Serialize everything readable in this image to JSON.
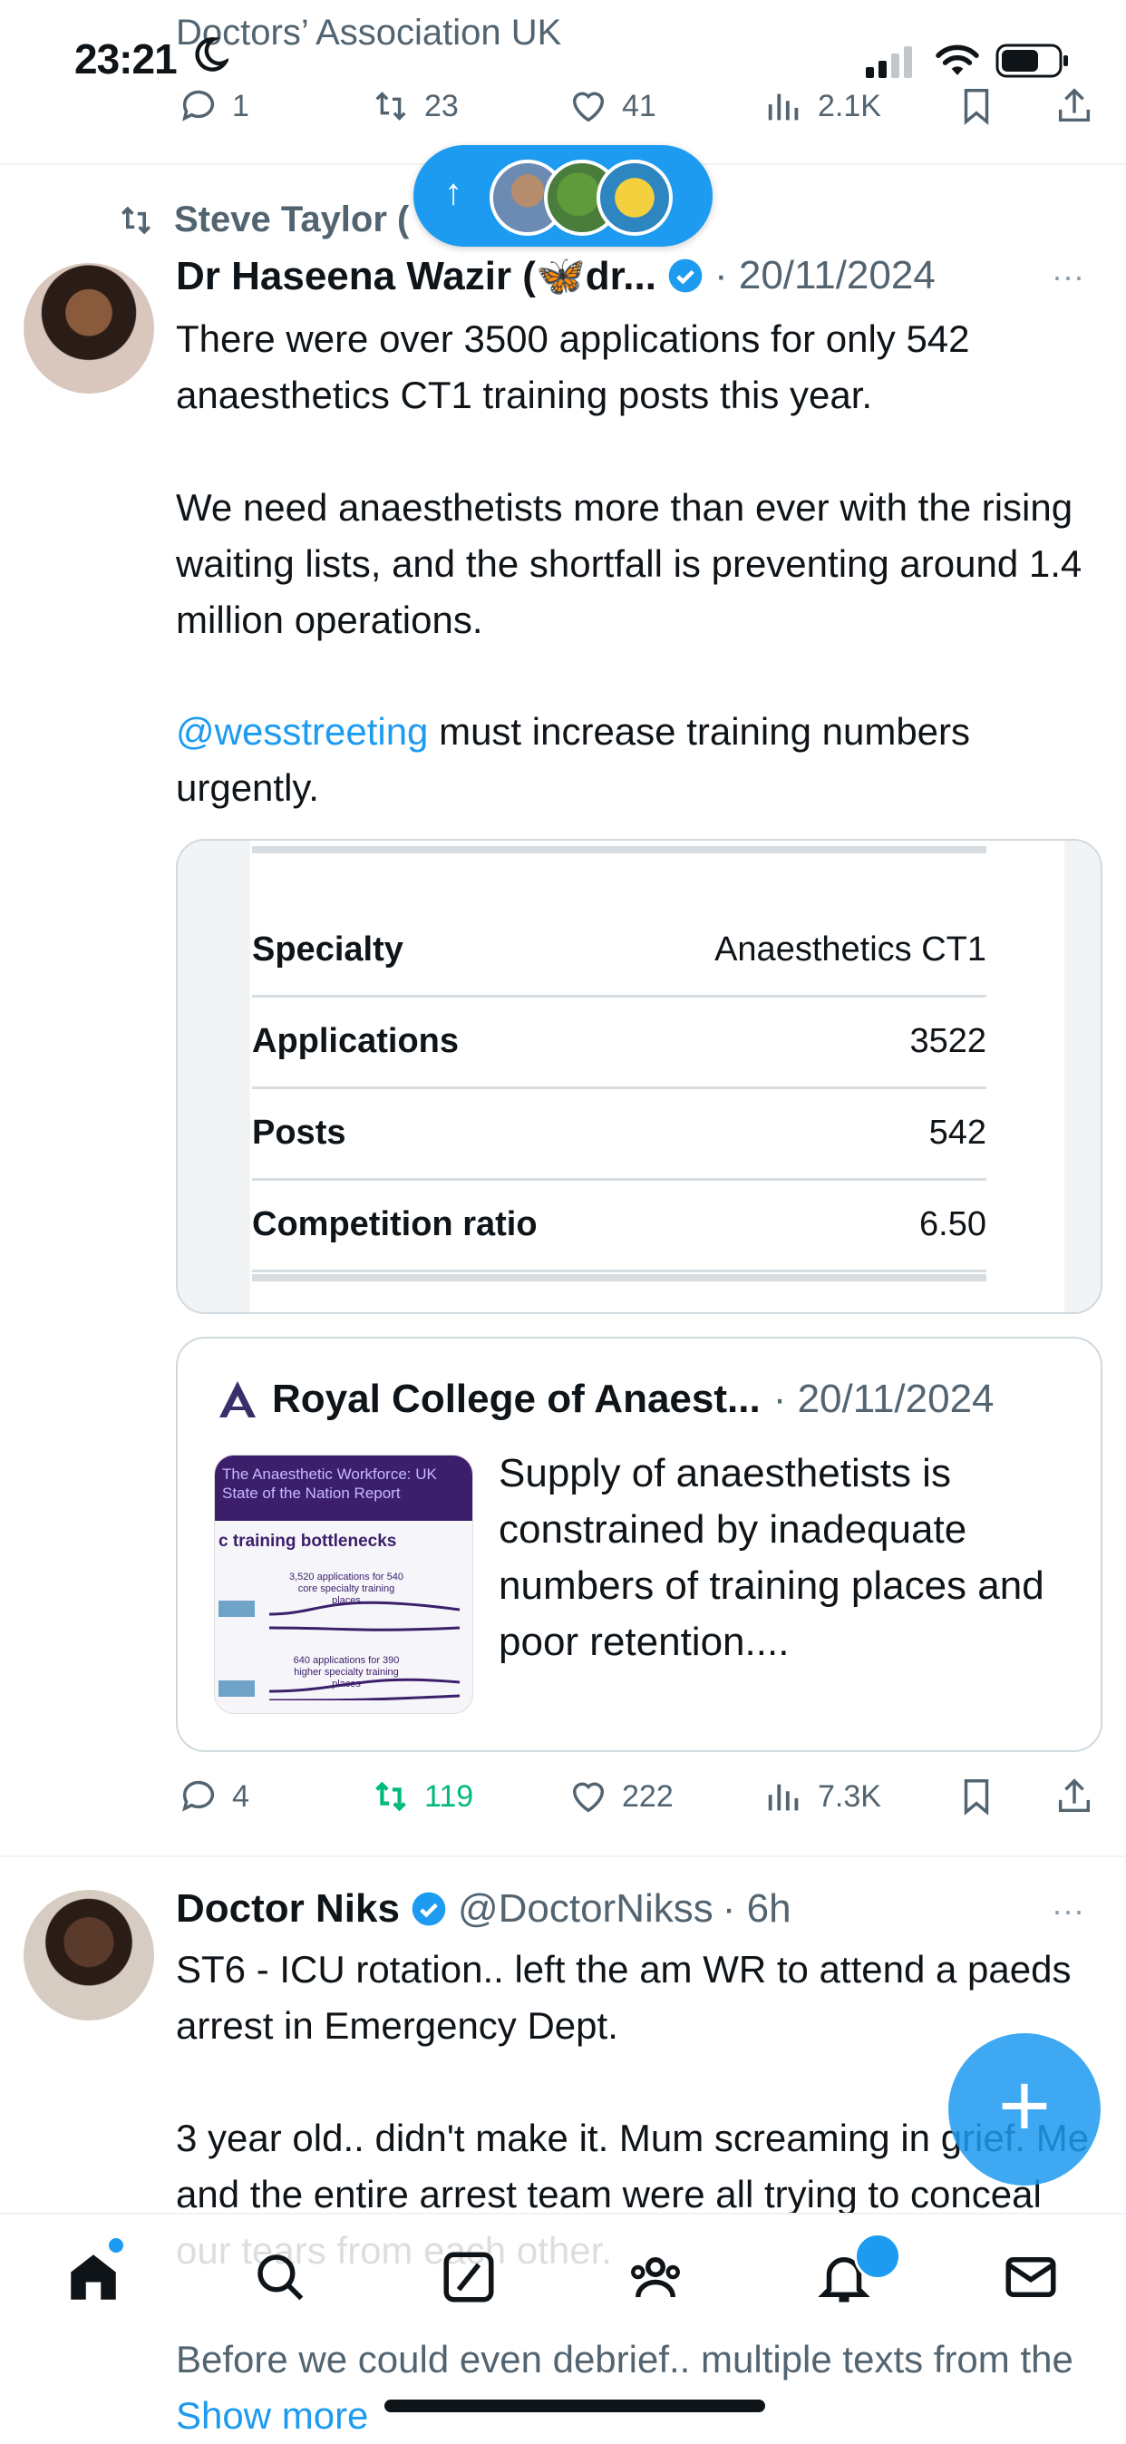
{
  "status": {
    "time": "23:21"
  },
  "previous_post": {
    "author_fragment": "Doctors’ Association UK",
    "replies": "1",
    "reposts": "23",
    "likes": "41",
    "views": "2.1K"
  },
  "new_posts_pill": {
    "arrow": "↑"
  },
  "post1": {
    "repost_by": "Steve Taylor (",
    "name": "Dr Haseena Wazir (🦋dr...",
    "date": "· 20/11/2024",
    "more": "···",
    "text_p1": "There were over 3500 applications for only 542 anaesthetics CT1 training posts this year.",
    "text_p2": "We need anaesthetists more than ever with the rising waiting lists, and the shortfall is preventing around 1.4 million operations.",
    "mention": "@wesstreeting",
    "text_p3": " must increase training numbers urgently.",
    "table": [
      {
        "k": "Specialty",
        "v": "Anaesthetics CT1"
      },
      {
        "k": "Applications",
        "v": "3522"
      },
      {
        "k": "Posts",
        "v": "542"
      },
      {
        "k": "Competition ratio",
        "v": "6.50"
      }
    ],
    "quote": {
      "name": "Royal College of Anaest...",
      "date": "· 20/11/2024",
      "text": "Supply of anaesthetists is constrained by inadequate numbers of training places and poor retention....",
      "thumb_title": "The Anaesthetic Workforce: UK State of the Nation Report",
      "thumb_heading": "c training bottlenecks",
      "thumb_label1": "3,520 applications for 540 core specialty training places",
      "thumb_label2": "640 applications for 390 higher specialty training places"
    },
    "replies": "4",
    "reposts": "119",
    "likes": "222",
    "views": "7.3K"
  },
  "post2": {
    "name": "Doctor Niks",
    "handle": "@DoctorNikss",
    "time": "· 6h",
    "more": "···",
    "text_p1": "ST6 - ICU rotation.. left the am WR to attend a paeds arrest in Emergency Dept.",
    "text_p2": "3 year old.. didn't make it. Mum screaming in grief. Me and the entire arrest team were all trying to conceal our tears from each other.",
    "text_p3": "Before we could even debrief.. multiple texts from the",
    "show_more": "Show more"
  },
  "fab": {
    "symbol": "+"
  },
  "colors": {
    "accent": "#1d9bf0",
    "repost_active": "#00ba7c",
    "muted": "#536471"
  }
}
